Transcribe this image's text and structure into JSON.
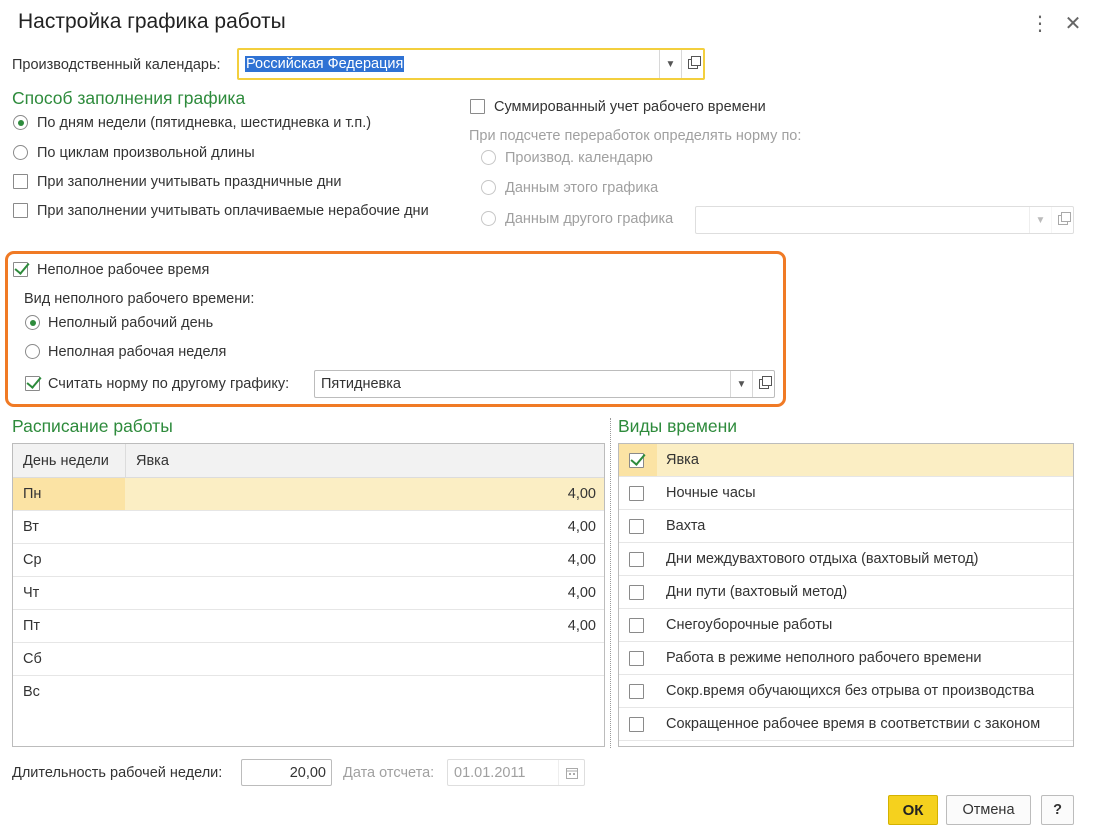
{
  "window": {
    "title": "Настройка графика работы",
    "more_icon": "more-vertical-icon",
    "close_icon": "close-icon"
  },
  "calendar": {
    "label": "Производственный календарь:",
    "value": "Российская Федерация"
  },
  "fill_method": {
    "section_title": "Способ заполнения графика",
    "by_weekdays": "По дням недели (пятидневка, шестидневка и т.п.)",
    "by_cycles": "По циклам произвольной длины",
    "holidays": "При заполнении учитывать праздничные дни",
    "paid_nonworking": "При заполнении учитывать оплачиваемые нерабочие дни"
  },
  "summarized": {
    "label": "Суммированный учет рабочего времени",
    "norm_label": "При подсчете переработок определять норму по:",
    "opt_calendar": "Производ. календарю",
    "opt_this": "Данным этого графика",
    "opt_other": "Данным другого графика",
    "other_value": ""
  },
  "part_time": {
    "label": "Неполное рабочее время",
    "kind_label": "Вид неполного рабочего времени:",
    "opt_day": "Неполный рабочий день",
    "opt_week": "Неполная рабочая неделя",
    "norm_label": "Считать норму по другому графику:",
    "norm_value": "Пятидневка"
  },
  "schedule": {
    "section_title": "Расписание работы",
    "col_day": "День недели",
    "col_attendance": "Явка",
    "rows": [
      {
        "day": "Пн",
        "value": "4,00"
      },
      {
        "day": "Вт",
        "value": "4,00"
      },
      {
        "day": "Ср",
        "value": "4,00"
      },
      {
        "day": "Чт",
        "value": "4,00"
      },
      {
        "day": "Пт",
        "value": "4,00"
      },
      {
        "day": "Сб",
        "value": ""
      },
      {
        "day": "Вс",
        "value": ""
      }
    ]
  },
  "time_types": {
    "section_title": "Виды времени",
    "items": [
      {
        "label": "Явка",
        "checked": true
      },
      {
        "label": "Ночные часы",
        "checked": false
      },
      {
        "label": "Вахта",
        "checked": false
      },
      {
        "label": "Дни междувахтового отдыха (вахтовый метод)",
        "checked": false
      },
      {
        "label": "Дни пути (вахтовый метод)",
        "checked": false
      },
      {
        "label": "Снегоуборочные работы",
        "checked": false
      },
      {
        "label": "Работа в режиме неполного рабочего времени",
        "checked": false
      },
      {
        "label": "Сокр.время обучающихся без отрыва от производства",
        "checked": false
      },
      {
        "label": "Сокращенное рабочее время в соответствии с законом",
        "checked": false
      }
    ]
  },
  "footer": {
    "week_length_label": "Длительность рабочей недели:",
    "week_length_value": "20,00",
    "ref_date_label": "Дата отсчета:",
    "ref_date_value": "01.01.2011",
    "ok": "ОК",
    "cancel": "Отмена",
    "help": "?"
  },
  "colors": {
    "accent_green": "#2e8b3c",
    "highlight_orange": "#f07a25",
    "ok_yellow": "#f5d11e",
    "selected_row": "#fbeec4"
  }
}
